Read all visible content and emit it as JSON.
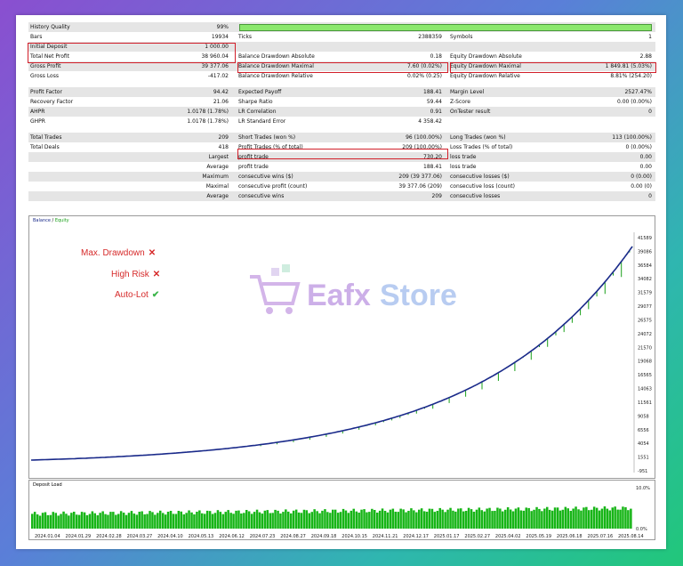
{
  "report": {
    "rows": [
      {
        "l1": "History Quality",
        "v1": "99%",
        "l2": "",
        "v2": "",
        "l3": "",
        "v3": ""
      },
      {
        "l1": "Bars",
        "v1": "19934",
        "l2": "Ticks",
        "v2": "2388359",
        "l3": "Symbols",
        "v3": "1"
      },
      {
        "l1": "Initial Deposit",
        "v1": "1 000.00",
        "l2": "",
        "v2": "",
        "l3": "",
        "v3": ""
      },
      {
        "l1": "Total Net Profit",
        "v1": "38 960.04",
        "l2": "Balance Drawdown Absolute",
        "v2": "0.18",
        "l3": "Equity Drawdown Absolute",
        "v3": "2.88"
      },
      {
        "l1": "Gross Profit",
        "v1": "39 377.06",
        "l2": "Balance Drawdown Maximal",
        "v2": "7.60 (0.02%)",
        "l3": "Equity Drawdown Maximal",
        "v3": "1 849.81 (5.03%)"
      },
      {
        "l1": "Gross Loss",
        "v1": "-417.02",
        "l2": "Balance Drawdown Relative",
        "v2": "0.02% (0.25)",
        "l3": "Equity Drawdown Relative",
        "v3": "8.81% (254.20)"
      },
      {
        "gap": true
      },
      {
        "l1": "Profit Factor",
        "v1": "94.42",
        "l2": "Expected Payoff",
        "v2": "188.41",
        "l3": "Margin Level",
        "v3": "2527.47%"
      },
      {
        "l1": "Recovery Factor",
        "v1": "21.06",
        "l2": "Sharpe Ratio",
        "v2": "59.44",
        "l3": "Z-Score",
        "v3": "0.00 (0.00%)"
      },
      {
        "l1": "AHPR",
        "v1": "1.0178 (1.78%)",
        "l2": "LR Correlation",
        "v2": "0.91",
        "l3": "OnTester result",
        "v3": "0"
      },
      {
        "l1": "GHPR",
        "v1": "1.0178 (1.78%)",
        "l2": "LR Standard Error",
        "v2": "4 358.42",
        "l3": "",
        "v3": ""
      },
      {
        "gap": true
      },
      {
        "l1": "Total Trades",
        "v1": "209",
        "l2": "Short Trades (won %)",
        "v2": "96 (100.00%)",
        "l3": "Long Trades (won %)",
        "v3": "113 (100.00%)"
      },
      {
        "l1": "Total Deals",
        "v1": "418",
        "l2": "Profit Trades (% of total)",
        "v2": "209 (100.00%)",
        "l3": "Loss Trades (% of total)",
        "v3": "0 (0.00%)"
      },
      {
        "r1": "Largest",
        "l2": "profit trade",
        "v2": "730.20",
        "l3": "loss trade",
        "v3": "0.00"
      },
      {
        "r1": "Average",
        "l2": "profit trade",
        "v2": "188.41",
        "l3": "loss trade",
        "v3": "0.00"
      },
      {
        "r1": "Maximum",
        "l2": "consecutive wins ($)",
        "v2": "209 (39 377.06)",
        "l3": "consecutive losses ($)",
        "v3": "0 (0.00)"
      },
      {
        "r1": "Maximal",
        "l2": "consecutive profit (count)",
        "v2": "39 377.06 (209)",
        "l3": "consecutive loss (count)",
        "v3": "0.00 (0)"
      },
      {
        "r1": "Average",
        "l2": "consecutive wins",
        "v2": "209",
        "l3": "consecutive losses",
        "v3": "0"
      }
    ]
  },
  "balance_chart": {
    "legend_balance": "Balance",
    "legend_sep": " / ",
    "legend_equity": "Equity",
    "y_ticks": [
      "41589",
      "39086",
      "36584",
      "34082",
      "31579",
      "29077",
      "26575",
      "24072",
      "21570",
      "19068",
      "16565",
      "14063",
      "11561",
      "9058",
      "6556",
      "4054",
      "1551",
      "-951"
    ],
    "balance_color": "#1a2a8a",
    "equity_color": "#1aa01a"
  },
  "load_chart": {
    "title": "Deposit Load",
    "y_top": "10.0%",
    "y_bottom": "0.0%",
    "bar_color": "#17b517"
  },
  "x_dates": [
    "2024.01.04",
    "2024.01.29",
    "2024.02.28",
    "2024.03.27",
    "2024.04.10",
    "2024.05.13",
    "2024.06.12",
    "2024.07.23",
    "2024.08.27",
    "2024.09.18",
    "2024.10.15",
    "2024.11.21",
    "2024.12.17",
    "2025.01.17",
    "2025.02.27",
    "2025.04.02",
    "2025.05.19",
    "2025.06.18",
    "2025.07.16",
    "2025.08.14"
  ],
  "badges": {
    "drawdown": "Max. Drawdown",
    "risk": "High Risk",
    "autolot": "Auto-Lot",
    "cross": "✕",
    "check": "✔"
  },
  "watermark": {
    "text1": "Eafx",
    "text2": "Store"
  },
  "colors": {
    "highlight": "#d21f2a",
    "quality": "#8be86d",
    "badge": "#d62a2a",
    "check": "#3bb54a"
  }
}
